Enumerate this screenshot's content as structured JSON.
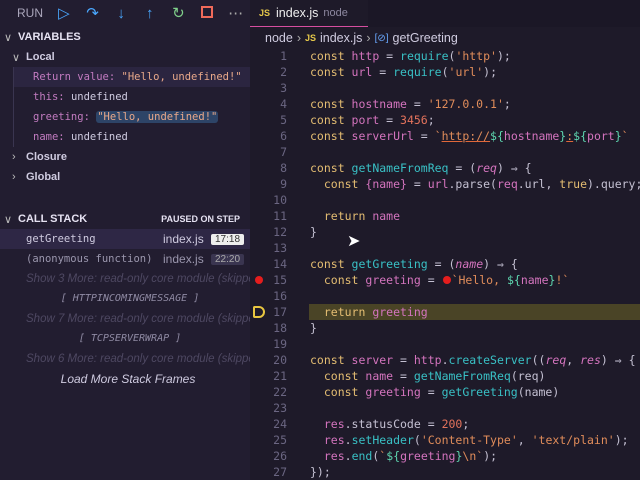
{
  "toolbar": {
    "run_label": "RUN",
    "buttons": [
      "continue-icon",
      "step-over-icon",
      "step-into-icon",
      "step-out-icon",
      "restart-icon",
      "stop-icon",
      "more-icon"
    ]
  },
  "variables": {
    "title": "VARIABLES",
    "local": "Local",
    "items": [
      {
        "name": "Return value",
        "value": "\"Hello, undefined!\""
      },
      {
        "name": "this",
        "value": "undefined"
      },
      {
        "name": "greeting",
        "value": "\"Hello, undefined!\""
      },
      {
        "name": "name",
        "value": "undefined"
      }
    ],
    "closure": "Closure",
    "global": "Global"
  },
  "callstack": {
    "title": "CALL STACK",
    "status": "PAUSED ON STEP",
    "frames": [
      {
        "fn": "getGreeting",
        "file": "index.js",
        "pos": "17:18"
      },
      {
        "fn": "(anonymous function)",
        "file": "index.js",
        "pos": "22:20"
      }
    ],
    "more": [
      "Show 3 More: read-only core module (skipped)",
      "Show 7 More: read-only core module (skipped)",
      "Show 6 More: read-only core module (skipped)"
    ],
    "groups": [
      "[ HTTPINCOMINGMESSAGE ]",
      "[ TCPSERVERWRAP ]"
    ],
    "load_more": "Load More Stack Frames"
  },
  "editor": {
    "tab": {
      "icon": "JS",
      "name": "index.js",
      "desc": "node"
    },
    "breadcrumb": [
      "node",
      "index.js",
      "getGreeting"
    ],
    "current_line": 17,
    "breakpoint_line": 15,
    "lines": [
      [
        [
          "const ",
          "k"
        ],
        [
          "http",
          "v"
        ],
        [
          " = ",
          "p"
        ],
        [
          "require",
          "f"
        ],
        [
          "(",
          "p"
        ],
        [
          "'http'",
          "s"
        ],
        [
          ");",
          "p"
        ]
      ],
      [
        [
          "const ",
          "k"
        ],
        [
          "url",
          "v"
        ],
        [
          " = ",
          "p"
        ],
        [
          "require",
          "f"
        ],
        [
          "(",
          "p"
        ],
        [
          "'url'",
          "s"
        ],
        [
          ");",
          "p"
        ]
      ],
      [],
      [
        [
          "const ",
          "k"
        ],
        [
          "hostname",
          "v"
        ],
        [
          " = ",
          "p"
        ],
        [
          "'127.0.0.1'",
          "s"
        ],
        [
          ";",
          "p"
        ]
      ],
      [
        [
          "const ",
          "k"
        ],
        [
          "port",
          "v"
        ],
        [
          " = ",
          "p"
        ],
        [
          "3456",
          "n"
        ],
        [
          ";",
          "p"
        ]
      ],
      [
        [
          "const ",
          "k"
        ],
        [
          "serverUrl",
          "v"
        ],
        [
          " = ",
          "p"
        ],
        [
          "`",
          "s"
        ],
        [
          "http://",
          "u"
        ],
        [
          "${",
          "t"
        ],
        [
          "hostname",
          "v"
        ],
        [
          "}",
          "t"
        ],
        [
          ":",
          "u"
        ],
        [
          "${",
          "t"
        ],
        [
          "port",
          "v"
        ],
        [
          "}",
          "t"
        ],
        [
          "`",
          "s"
        ]
      ],
      [],
      [
        [
          "const ",
          "k"
        ],
        [
          "getNameFromReq",
          "f"
        ],
        [
          " = (",
          "p"
        ],
        [
          "req",
          "i"
        ],
        [
          ") ⇒ {",
          "p"
        ]
      ],
      [
        [
          "  const ",
          "k"
        ],
        [
          "{name}",
          "v"
        ],
        [
          " = ",
          "p"
        ],
        [
          "url",
          "v"
        ],
        [
          ".parse(",
          "p"
        ],
        [
          "req",
          "v"
        ],
        [
          ".url, ",
          "p"
        ],
        [
          "true",
          "k"
        ],
        [
          ").query;",
          "p"
        ]
      ],
      [],
      [
        [
          "  return ",
          "k"
        ],
        [
          "name",
          "v"
        ]
      ],
      [
        [
          "}",
          "p"
        ]
      ],
      [],
      [
        [
          "const ",
          "k"
        ],
        [
          "getGreeting",
          "f"
        ],
        [
          " = (",
          "p"
        ],
        [
          "name",
          "i"
        ],
        [
          ") ⇒ {",
          "p"
        ]
      ],
      [
        [
          "  const ",
          "k"
        ],
        [
          "greeting",
          "v"
        ],
        [
          " = ",
          "p"
        ],
        [
          "●",
          "bp"
        ],
        [
          "`Hello, ",
          "s"
        ],
        [
          "${",
          "t"
        ],
        [
          "name",
          "v"
        ],
        [
          "}",
          "t"
        ],
        [
          "!`",
          "s"
        ]
      ],
      [],
      [
        [
          "  return ",
          "k"
        ],
        [
          "greeting",
          "v"
        ]
      ],
      [
        [
          "}",
          "p"
        ]
      ],
      [],
      [
        [
          "const ",
          "k"
        ],
        [
          "server",
          "v"
        ],
        [
          " = ",
          "p"
        ],
        [
          "http",
          "v"
        ],
        [
          ".",
          "p"
        ],
        [
          "createServer",
          "f"
        ],
        [
          "((",
          "p"
        ],
        [
          "req",
          "i"
        ],
        [
          ", ",
          "p"
        ],
        [
          "res",
          "i"
        ],
        [
          ") ⇒ {",
          "p"
        ]
      ],
      [
        [
          "  const ",
          "k"
        ],
        [
          "name",
          "v"
        ],
        [
          " = ",
          "p"
        ],
        [
          "getNameFromReq",
          "f"
        ],
        [
          "(req)",
          "p"
        ]
      ],
      [
        [
          "  const ",
          "k"
        ],
        [
          "greeting",
          "v"
        ],
        [
          " = ",
          "p"
        ],
        [
          "getGreeting",
          "f"
        ],
        [
          "(name)",
          "p"
        ]
      ],
      [],
      [
        [
          "  res",
          "v"
        ],
        [
          ".statusCode = ",
          "p"
        ],
        [
          "200",
          "n"
        ],
        [
          ";",
          "p"
        ]
      ],
      [
        [
          "  res",
          "v"
        ],
        [
          ".",
          "p"
        ],
        [
          "setHeader",
          "f"
        ],
        [
          "(",
          "p"
        ],
        [
          "'Content-Type'",
          "s"
        ],
        [
          ", ",
          "p"
        ],
        [
          "'text/plain'",
          "s"
        ],
        [
          ");",
          "p"
        ]
      ],
      [
        [
          "  res",
          "v"
        ],
        [
          ".",
          "p"
        ],
        [
          "end",
          "f"
        ],
        [
          "(",
          "p"
        ],
        [
          "`",
          "s"
        ],
        [
          "${",
          "t"
        ],
        [
          "greeting",
          "v"
        ],
        [
          "}",
          "t"
        ],
        [
          "\\n`",
          "s"
        ],
        [
          ");",
          "p"
        ]
      ],
      [
        [
          "});",
          "p"
        ]
      ]
    ]
  }
}
